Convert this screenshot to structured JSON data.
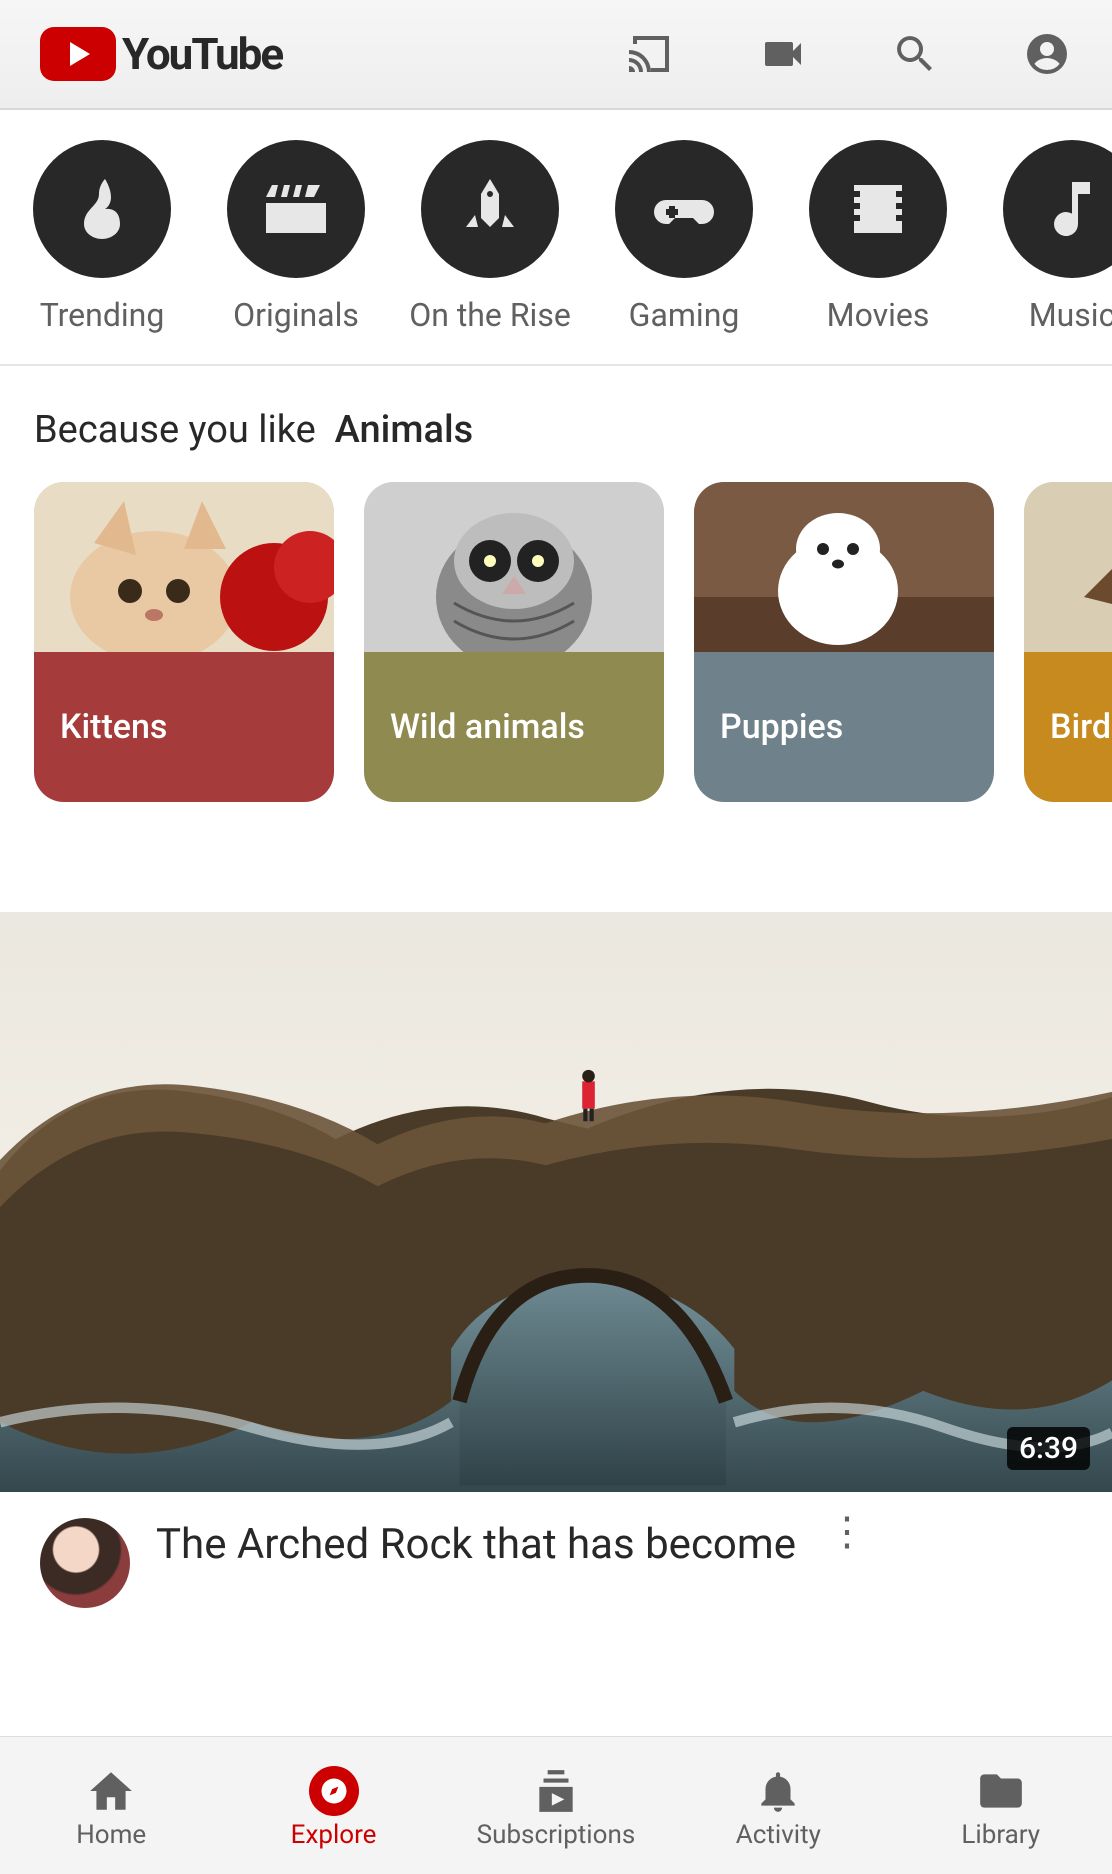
{
  "app": {
    "name": "YouTube"
  },
  "categories": [
    {
      "id": "trending",
      "label": "Trending"
    },
    {
      "id": "originals",
      "label": "Originals"
    },
    {
      "id": "ontherise",
      "label": "On the Rise"
    },
    {
      "id": "gaming",
      "label": "Gaming"
    },
    {
      "id": "movies",
      "label": "Movies"
    },
    {
      "id": "music",
      "label": "Music"
    }
  ],
  "because": {
    "prefix": "Because you like",
    "topic": "Animals",
    "cards": [
      {
        "label": "Kittens",
        "color": "#a63b3b"
      },
      {
        "label": "Wild animals",
        "color": "#8f8a4f"
      },
      {
        "label": "Puppies",
        "color": "#6f828c"
      },
      {
        "label": "Birds",
        "color": "#c78a1e"
      }
    ]
  },
  "video": {
    "title": "The Arched Rock that has become",
    "duration": "6:39"
  },
  "nav": {
    "home": "Home",
    "explore": "Explore",
    "subscriptions": "Subscriptions",
    "activity": "Activity",
    "library": "Library"
  }
}
